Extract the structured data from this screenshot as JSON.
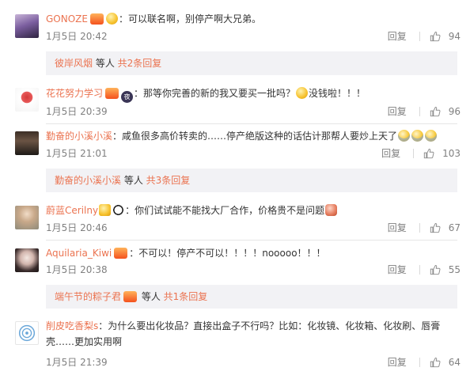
{
  "comments": [
    {
      "username": "GONOZE",
      "text": "：可以联名啊，别停产啊大兄弟。",
      "time": "1月5日 20:42",
      "reply": "回复",
      "likes": "94"
    },
    {
      "username": "花花努力学习",
      "text": "：那等你完善的新的我又要买一批吗？",
      "text2": "没钱啦！！！",
      "time": "1月5日 20:39",
      "reply": "回复",
      "likes": "96"
    },
    {
      "username": "勤奋的小溪小溪",
      "text": "：咸鱼很多高价转卖的……停产绝版这种的话估计那帮人要炒上天了",
      "time": "1月5日 21:01",
      "reply": "回复",
      "likes": "103"
    },
    {
      "username": "蔚蓝Cerilny",
      "text": "：你们试试能不能找大厂合作，价格贵不是问题",
      "time": "1月5日 20:46",
      "reply": "回复",
      "likes": "67"
    },
    {
      "username": "Aquilaria_Kiwi",
      "text": "：不可以！停产不可以！！！！nooooo！！！",
      "time": "1月5日 20:38",
      "reply": "回复",
      "likes": "55"
    },
    {
      "username": "削皮吃香梨s",
      "text": "：为什么要出化妆品？直接出盒子不行吗？比如：化妆镜、化妆箱、化妆刷、唇膏壳……更加实用啊",
      "time": "1月5日 21:39",
      "reply": "回复",
      "likes": "64"
    }
  ],
  "subreplies": [
    {
      "name": "彼岸风烟",
      "mid": " 等人 ",
      "link": "共2条回复"
    },
    {
      "name": "勤奋的小溪小溪",
      "mid": " 等人 ",
      "link": "共3条回复"
    },
    {
      "name": "端午节的粽子君",
      "mid": " 等人 ",
      "link": "共1条回复"
    }
  ],
  "colors": {
    "accent": "#eb7350",
    "meta": "#808080",
    "subbox_bg": "#f2f2f5"
  }
}
